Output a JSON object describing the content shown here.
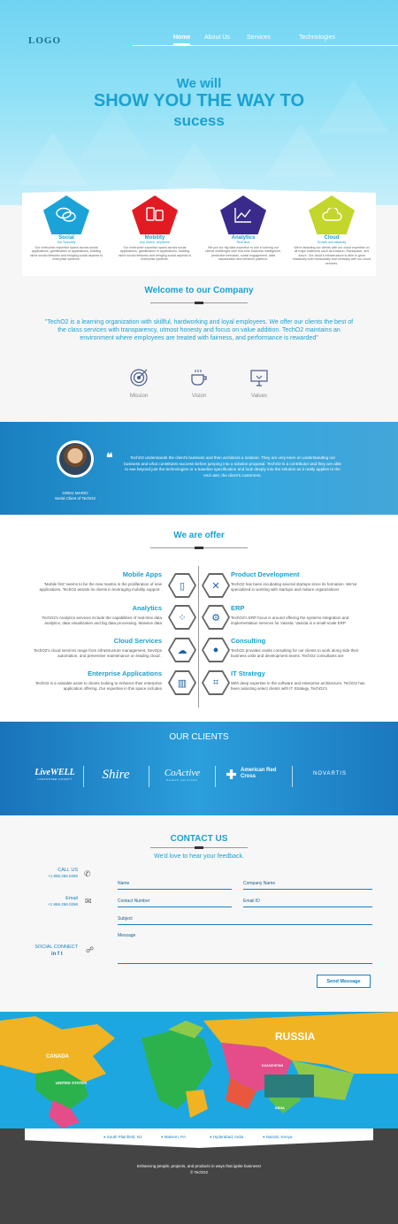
{
  "header": {
    "logo": "LOGO",
    "nav": [
      "Home",
      "About Us",
      "Services",
      "Technologies"
    ]
  },
  "hero": {
    "line1": "We will",
    "line2": "SHOW YOU THE WAY TO",
    "line3": "sucess"
  },
  "features": [
    {
      "title": "Social",
      "subtitle": "Our Specialty",
      "icon": "chat-bubbles-icon",
      "color": "#1ba3d8",
      "text": "Our enterprise expertise spans across social applications, gamification of applications, building niche social networks and bringing social aspects to enterprise systems."
    },
    {
      "title": "Mobility",
      "subtitle": "Any device, anywhere",
      "icon": "mobile-devices-icon",
      "color": "#e21b23",
      "text": "Our enterprise expertise spans across social applications, gamification of applications, building niche social networks and bringing social aspects to enterprise systems."
    },
    {
      "title": "Analytics",
      "subtitle": "Real time",
      "icon": "chart-icon",
      "color": "#3a2a8c",
      "text": "We put our big data expertise to use in solving our clients challenges with real-time business intelligence, predictive forecasts, social engagement, data visualization and behavior patterns."
    },
    {
      "title": "Cloud",
      "subtitle": "Growth and elasticity",
      "icon": "cloud-icon",
      "color": "#c3d62b",
      "text": "We're assisting our clients with our cloud expertise on all major platforms such as Amazon, Rackspace, and Azure. Our cloud's infrastructure is able to grow elastically both horizontally and vertically with our cloud services."
    }
  ],
  "welcome": {
    "title": "Welcome to our Company",
    "quote": "\"TechO2 is a learning organization with skillful, hardworking and loyal employees. We offer our clients the best of the class services with transparency, utmost honesty and focus on value addition. TechO2 maintains an environment where employees are treated with fairness, and performance is rewarded\"",
    "values": [
      {
        "label": "Mission",
        "icon": "target-icon"
      },
      {
        "label": "Vision",
        "icon": "coffee-cup-icon"
      },
      {
        "label": "Values",
        "icon": "monitor-icon"
      }
    ]
  },
  "testimonial": {
    "text": "TechO2 understands the client's business and then architects a solution. They are very keen on understanding our business and what constitutes success before jumping into a solution proposal. TechO2 is a contributor and they are able to see beyond just the technologies or a baseline specification and look deeply into the solution as it really applies to the end user, the client's customers.",
    "name": "GREG MARIO",
    "role": "Serial Client of TechO2"
  },
  "offer": {
    "title": "We are offer",
    "left": [
      {
        "title": "Mobile Apps",
        "icon": "smartphone-icon",
        "text": "'Mobile first' seems to be the new mantra in the proliferation of new applications. TechO2 assists its clients in leveraging mobility support ."
      },
      {
        "title": "Analytics",
        "icon": "network-nodes-icon",
        "text": "TechO2's Analytics services include the capabilities of real-time data analytics, data visualization and big data processing. Massive data"
      },
      {
        "title": "Cloud Services",
        "icon": "clouds-icon",
        "text": "TechO2's cloud services range from infrastructure management, DevOps automation, and preventive maintenance on leading cloud ."
      },
      {
        "title": "Enterprise Applications",
        "icon": "buildings-icon",
        "text": "TechO2 is a valuable asset to clients looking to enhance their enterprise application offering. Our expertise in this space includes"
      }
    ],
    "right": [
      {
        "title": "Product Development",
        "icon": "tools-icon",
        "text": "TechO2 has been incubating several startups since its formation. We've specialized in working with startups and mature organizations"
      },
      {
        "title": "ERP",
        "icon": "gear-list-icon",
        "text": "TechO2's ERP focus is around offering the systems integration and implementation services for Vasista. Vasista is a small-scale ERP"
      },
      {
        "title": "Consulting",
        "icon": "speech-bubbles-icon",
        "text": "TechO2 provides onsite consulting for our clients to work along side their business units and development teams. TechO2 consultants are"
      },
      {
        "title": "IT Strategy",
        "icon": "flowchart-icon",
        "text": "With deep expertise in the software and enterprise architecture, TechO2 has been assisting select clients with IT Strategy. TechO2's"
      }
    ]
  },
  "clients": {
    "title": "OUR CLIENTS",
    "logos": [
      {
        "name": "LiveWELL",
        "sub": "LANCASTER COUNTY"
      },
      {
        "name": "Shire",
        "sub": ""
      },
      {
        "name": "CoActive",
        "sub": "health services"
      },
      {
        "name": "American Red Cross",
        "sub": ""
      },
      {
        "name": "NOVARTIS",
        "sub": ""
      }
    ]
  },
  "contact": {
    "title": "CONTACT US",
    "subtitle": "We'd love to hear your feedback.",
    "call_label": "CALL US",
    "call_value": "+1 866.266.0286",
    "email_label": "Email",
    "email_value": "+1 866.266.0286",
    "social_label": "SOCIAL CONNECT",
    "fields": {
      "name": "Name",
      "company": "Company Name",
      "number": "Contact Number",
      "email": "Email ID",
      "subject": "Subject",
      "message": "Message"
    },
    "send": "Send Message"
  },
  "map": {
    "labels": [
      "RUSSIA",
      "CANADA",
      "UNITED STATES",
      "KAZAKHSTAN",
      "INDIA"
    ]
  },
  "footer": {
    "locations": [
      "South Plainfield, NJ",
      "Malvern, PA",
      "Hyderabad, India",
      "Nairobi, Kenya"
    ],
    "tagline": "Enhancing people, projects, and products in ways that ignite business!",
    "copyright": "© TechO2"
  },
  "colors": {
    "accent": "#1aa1d1",
    "dark": "#444444"
  }
}
